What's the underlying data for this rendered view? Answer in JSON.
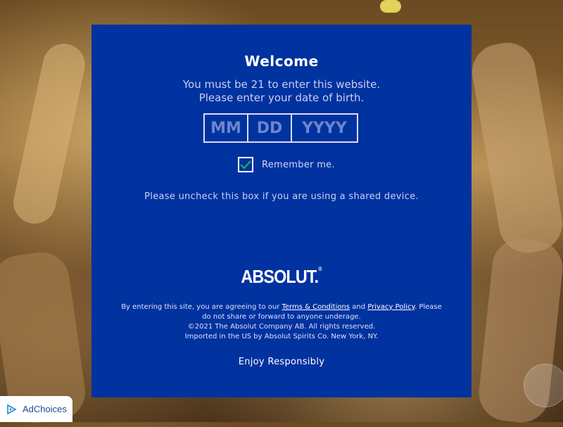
{
  "modal": {
    "title": "Welcome",
    "subtitle_line1": "You must be 21 to enter this website.",
    "subtitle_line2": "Please enter your date of birth.",
    "dob": {
      "month_placeholder": "MM",
      "day_placeholder": "DD",
      "year_placeholder": "YYYY"
    },
    "remember_label": "Remember me.",
    "remember_checked": true,
    "notice": "Please uncheck this box if you are using a shared device.",
    "logo_text": "ABSOLUT",
    "logo_mark": ".",
    "legal": {
      "prefix": "By entering this site, you are agreeing to our",
      "terms_link": "Terms & Conditions",
      "and": "and",
      "privacy_link": "Privacy Policy",
      "suffix": ". Please do not share or forward to anyone underage.",
      "copyright": "©2021 The Absolut Company AB. All rights reserved.",
      "importer": "Imported in the US by Absolut Spirits Co. New York, NY."
    },
    "enjoy": "Enjoy Responsibly"
  },
  "adchoices": {
    "label": "AdChoices",
    "icon": "adchoices-icon"
  },
  "colors": {
    "modal_bg": "#0032a0",
    "checkmark": "#22b14c"
  }
}
